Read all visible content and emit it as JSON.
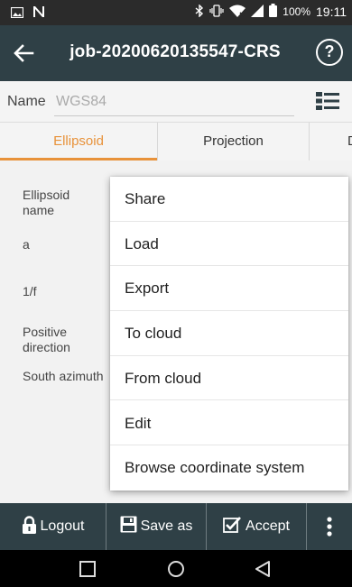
{
  "status_bar": {
    "battery_percent": "100%",
    "time": "19:11",
    "left_icons": [
      "image-icon",
      "n-icon"
    ],
    "right_icons": [
      "bluetooth-icon",
      "vibrate-icon",
      "wifi-icon",
      "signal-icon",
      "battery-icon"
    ]
  },
  "app_bar": {
    "title": "job-20200620135547-CRS",
    "help_label": "?",
    "back_icon": "arrow-left-icon"
  },
  "name_field": {
    "label": "Name",
    "value": "WGS84",
    "menu_icon": "list-icon"
  },
  "tabs": [
    {
      "label": "Ellipsoid",
      "active": true
    },
    {
      "label": "Projection",
      "active": false
    },
    {
      "label": "D",
      "active": false
    }
  ],
  "fields": [
    {
      "label": "Ellipsoid name"
    },
    {
      "label": "a"
    },
    {
      "label": "1/f"
    },
    {
      "label": "Positive direction"
    },
    {
      "label": "South azimuth"
    }
  ],
  "menu": {
    "items": [
      "Share",
      "Load",
      "Export",
      "To cloud",
      "From cloud",
      "Edit",
      "Browse coordinate system"
    ]
  },
  "bottom_bar": {
    "logout": "Logout",
    "save_as": "Save as",
    "accept": "Accept",
    "more_icon": "more-vert-icon"
  },
  "nav_bar": {
    "icons": [
      "recent-apps-icon",
      "home-icon",
      "back-triangle-icon"
    ]
  },
  "colors": {
    "app_bar": "#2f4046",
    "accent": "#e8923a",
    "status_bar": "#2b2b2b"
  }
}
